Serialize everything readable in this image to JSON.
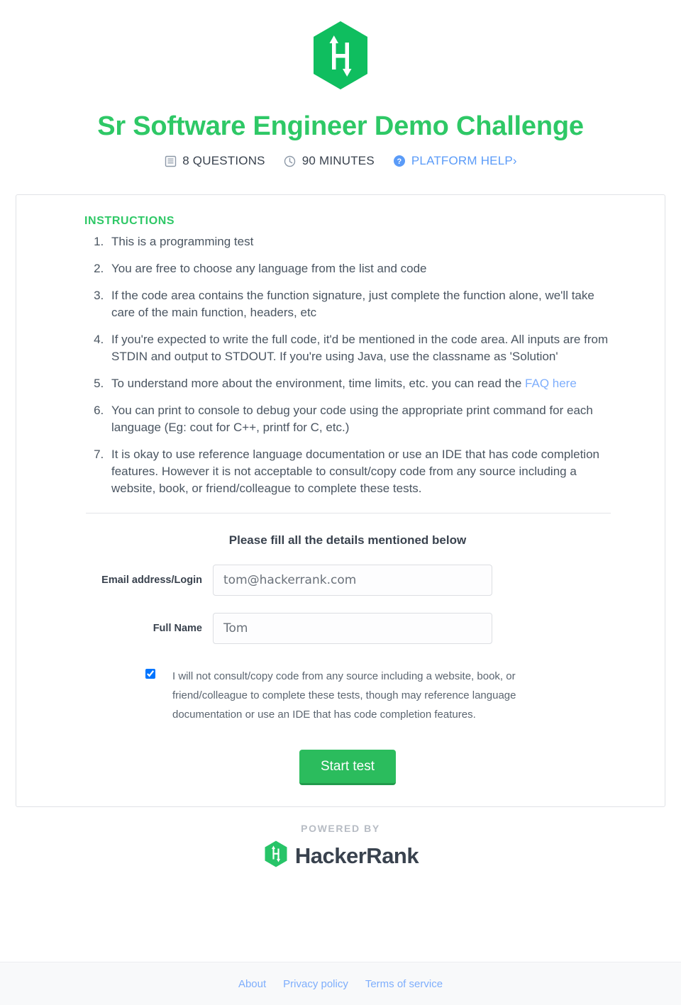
{
  "header": {
    "logo_icon": "hackerrank-hexagon-logo",
    "title": "Sr Software Engineer Demo Challenge",
    "meta": {
      "questions_icon": "document-list-icon",
      "questions": "8 QUESTIONS",
      "duration_icon": "clock-icon",
      "duration": "90 MINUTES",
      "help_icon": "question-mark-circle-icon",
      "help_label": "PLATFORM HELP›"
    }
  },
  "instructions": {
    "heading": "INSTRUCTIONS",
    "items": [
      {
        "text": "This is a programming test"
      },
      {
        "text": "You are free to choose any language from the list and code"
      },
      {
        "text": "If the code area contains the function signature, just complete the function alone, we'll take care of the main function, headers, etc"
      },
      {
        "text": "If you're expected to write the full code, it'd be mentioned in the code area. All inputs are from STDIN and output to STDOUT. If you're using Java, use the classname as 'Solution'"
      },
      {
        "text": "To understand more about the environment, time limits, etc. you can read the ",
        "link_text": "FAQ here"
      },
      {
        "text": "You can print to console to debug your code using the appropriate print command for each language (Eg: cout for C++, printf for C, etc.)"
      },
      {
        "text": "It is okay to use reference language documentation or use an IDE that has code completion features. However it is not acceptable to consult/copy code from any source including a website, book, or friend/colleague to complete these tests."
      }
    ]
  },
  "form": {
    "heading": "Please fill all the details mentioned below",
    "email": {
      "label": "Email address/Login",
      "value": "tom@hackerrank.com",
      "placeholder": "Email address/Login"
    },
    "fullname": {
      "label": "Full Name",
      "value": "Tom",
      "placeholder": "Full Name"
    },
    "consent": {
      "checked": true,
      "text": "I will not consult/copy code from any source including a website, book, or friend/colleague to complete these tests, though may reference language documentation or use an IDE that has code completion features."
    },
    "submit_label": "Start test"
  },
  "powered_by": {
    "label": "POWERED BY",
    "brand_icon": "hackerrank-hexagon-logo",
    "brand": "HackerRank"
  },
  "footer": {
    "links": [
      {
        "label": "About"
      },
      {
        "label": "Privacy policy"
      },
      {
        "label": "Terms of service"
      }
    ]
  },
  "colors": {
    "brand_green": "#2ec866",
    "button_green": "#2bbc5d",
    "link_blue": "#7eaefc",
    "help_blue": "#5a9bf8",
    "text_dark": "#39424e",
    "page_bg": "#ffffff",
    "footer_bg": "#f8f9fa",
    "border": "#e0e2e6"
  }
}
